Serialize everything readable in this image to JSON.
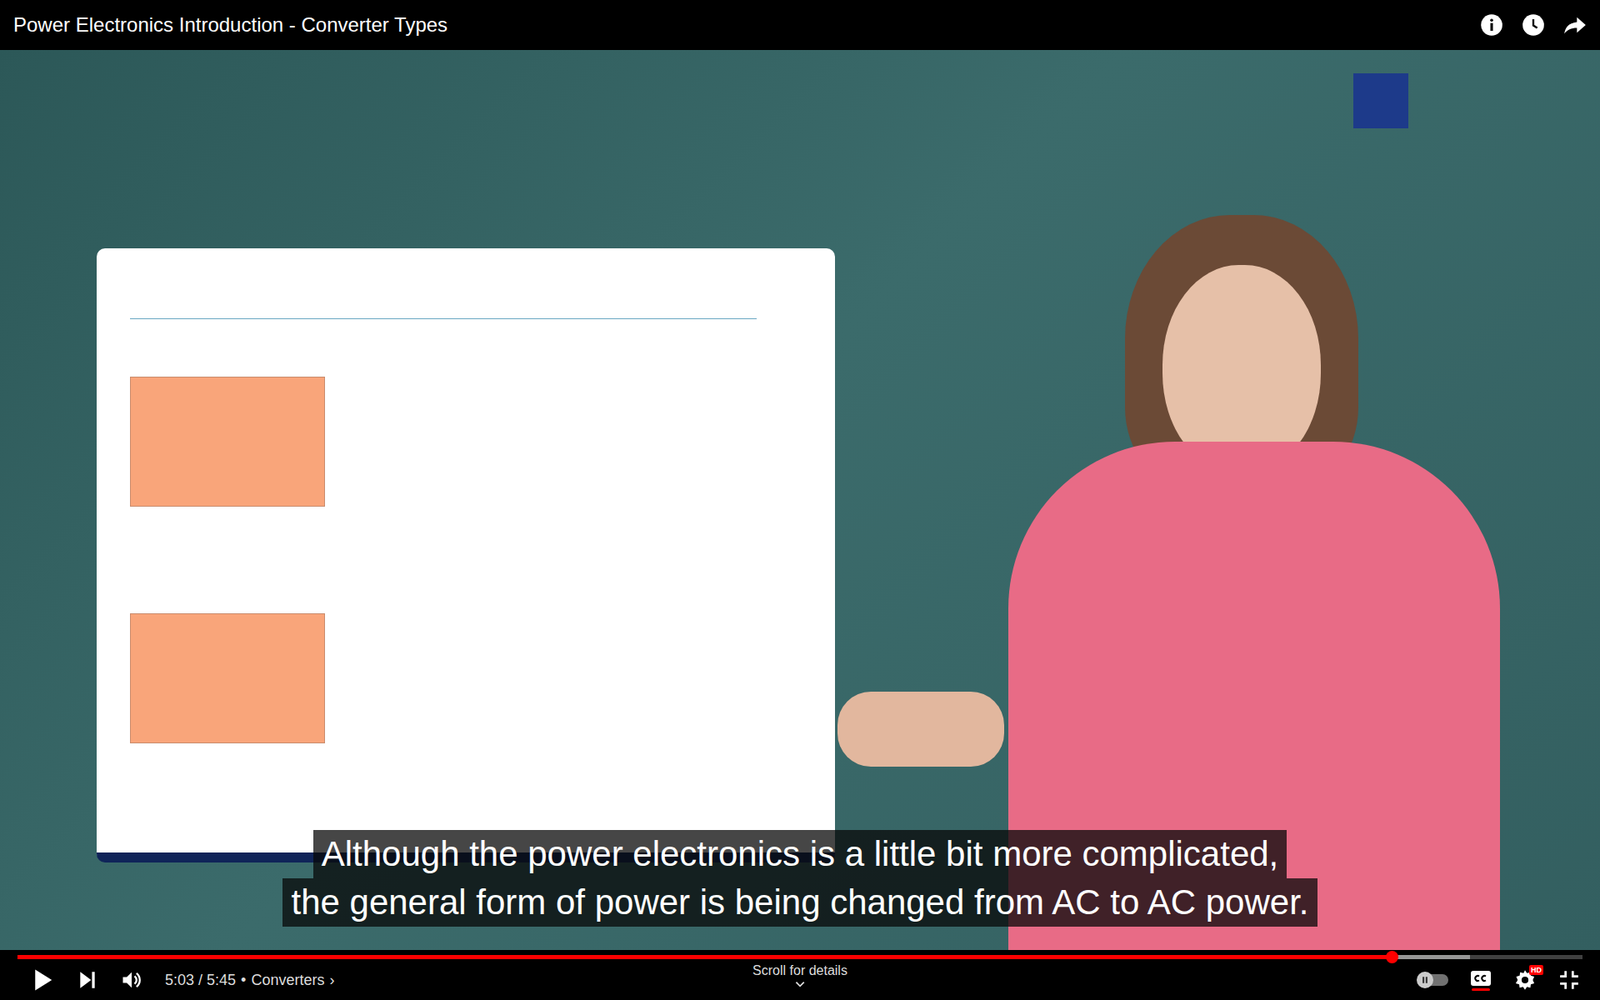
{
  "video": {
    "title": "Power Electronics Introduction - Converter Types",
    "playing": false
  },
  "captions": {
    "on": true,
    "lines": [
      "Although the power electronics is a little bit more complicated,",
      "the general form of power is being changed from AC to AC power."
    ]
  },
  "progress": {
    "level": 0.878,
    "buffered": 0.928
  },
  "controls": {
    "time": "5:03 / 5:45",
    "separator": "•",
    "chapter": "Converters",
    "chapter_arrow": "›",
    "scroll_hint": "Scroll for details",
    "autoplay": false,
    "quality_badge": "HD"
  }
}
